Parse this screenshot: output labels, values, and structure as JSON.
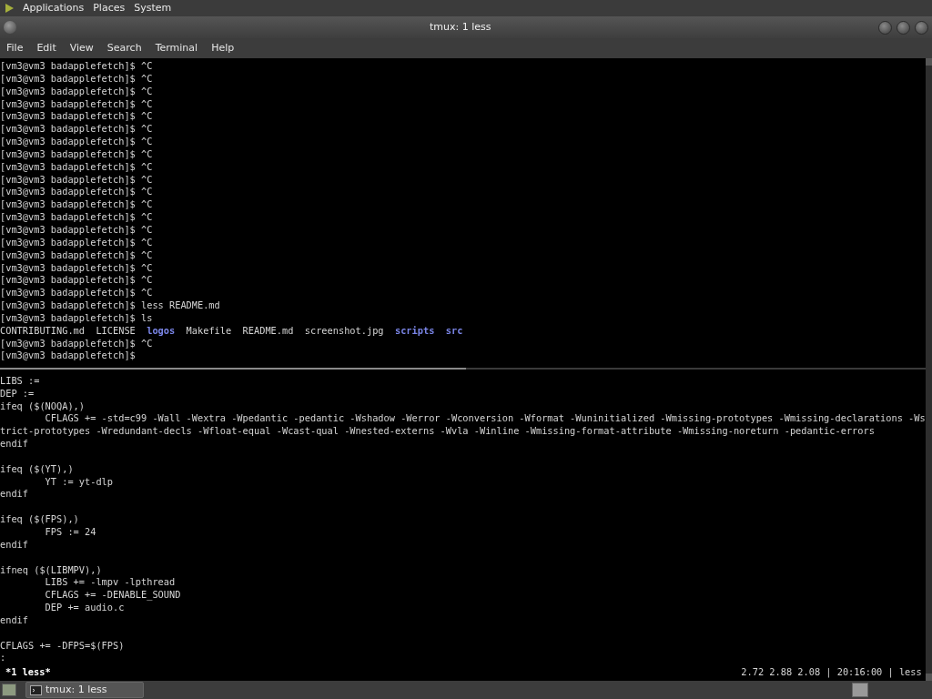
{
  "top_panel": {
    "menus": [
      "Applications",
      "Places",
      "System"
    ]
  },
  "window": {
    "title": "tmux: 1 less",
    "menubar": [
      "File",
      "Edit",
      "View",
      "Search",
      "Terminal",
      "Help"
    ]
  },
  "top_pane": {
    "active": true,
    "lines": [
      {
        "kind": "text",
        "text": "[vm3@vm3 badapplefetch]$ ^C"
      },
      {
        "kind": "text",
        "text": "[vm3@vm3 badapplefetch]$ ^C"
      },
      {
        "kind": "text",
        "text": "[vm3@vm3 badapplefetch]$ ^C"
      },
      {
        "kind": "text",
        "text": "[vm3@vm3 badapplefetch]$ ^C"
      },
      {
        "kind": "text",
        "text": "[vm3@vm3 badapplefetch]$ ^C"
      },
      {
        "kind": "text",
        "text": "[vm3@vm3 badapplefetch]$ ^C"
      },
      {
        "kind": "text",
        "text": "[vm3@vm3 badapplefetch]$ ^C"
      },
      {
        "kind": "text",
        "text": "[vm3@vm3 badapplefetch]$ ^C"
      },
      {
        "kind": "text",
        "text": "[vm3@vm3 badapplefetch]$ ^C"
      },
      {
        "kind": "text",
        "text": "[vm3@vm3 badapplefetch]$ ^C"
      },
      {
        "kind": "text",
        "text": "[vm3@vm3 badapplefetch]$ ^C"
      },
      {
        "kind": "text",
        "text": "[vm3@vm3 badapplefetch]$ ^C"
      },
      {
        "kind": "text",
        "text": "[vm3@vm3 badapplefetch]$ ^C"
      },
      {
        "kind": "text",
        "text": "[vm3@vm3 badapplefetch]$ ^C"
      },
      {
        "kind": "text",
        "text": "[vm3@vm3 badapplefetch]$ ^C"
      },
      {
        "kind": "text",
        "text": "[vm3@vm3 badapplefetch]$ ^C"
      },
      {
        "kind": "text",
        "text": "[vm3@vm3 badapplefetch]$ ^C"
      },
      {
        "kind": "text",
        "text": "[vm3@vm3 badapplefetch]$ ^C"
      },
      {
        "kind": "text",
        "text": "[vm3@vm3 badapplefetch]$ ^C"
      },
      {
        "kind": "text",
        "text": "[vm3@vm3 badapplefetch]$ less README.md"
      },
      {
        "kind": "text",
        "text": "[vm3@vm3 badapplefetch]$ ls"
      },
      {
        "kind": "listing",
        "entries": [
          {
            "text": "CONTRIBUTING.md",
            "kind": "file"
          },
          {
            "text": "LICENSE",
            "kind": "file"
          },
          {
            "text": "logos",
            "kind": "dir"
          },
          {
            "text": "Makefile",
            "kind": "file"
          },
          {
            "text": "README.md",
            "kind": "file"
          },
          {
            "text": "screenshot.jpg",
            "kind": "file"
          },
          {
            "text": "scripts",
            "kind": "dir"
          },
          {
            "text": "src",
            "kind": "dir"
          }
        ]
      },
      {
        "kind": "text",
        "text": "[vm3@vm3 badapplefetch]$ ^C"
      },
      {
        "kind": "text",
        "text": "[vm3@vm3 badapplefetch]$"
      }
    ]
  },
  "bottom_pane": {
    "lines": [
      {
        "kind": "text",
        "text": "LIBS :="
      },
      {
        "kind": "text",
        "text": "DEP :="
      },
      {
        "kind": "text",
        "text": "ifeq ($(NOQA),)"
      },
      {
        "kind": "text",
        "text": "        CFLAGS += -std=c99 -Wall -Wextra -Wpedantic -pedantic -Wshadow -Werror -Wconversion -Wformat -Wuninitialized -Wmissing-prototypes -Wmissing-declarations -Ws"
      },
      {
        "kind": "text",
        "text": "trict-prototypes -Wredundant-decls -Wfloat-equal -Wcast-qual -Wnested-externs -Wvla -Winline -Wmissing-format-attribute -Wmissing-noreturn -pedantic-errors"
      },
      {
        "kind": "text",
        "text": "endif"
      },
      {
        "kind": "blank"
      },
      {
        "kind": "text",
        "text": "ifeq ($(YT),)"
      },
      {
        "kind": "text",
        "text": "        YT := yt-dlp"
      },
      {
        "kind": "text",
        "text": "endif"
      },
      {
        "kind": "blank"
      },
      {
        "kind": "text",
        "text": "ifeq ($(FPS),)"
      },
      {
        "kind": "text",
        "text": "        FPS := 24"
      },
      {
        "kind": "text",
        "text": "endif"
      },
      {
        "kind": "blank"
      },
      {
        "kind": "text",
        "text": "ifneq ($(LIBMPV),)"
      },
      {
        "kind": "text",
        "text": "        LIBS += -lmpv -lpthread"
      },
      {
        "kind": "text",
        "text": "        CFLAGS += -DENABLE_SOUND"
      },
      {
        "kind": "text",
        "text": "        DEP += audio.c"
      },
      {
        "kind": "text",
        "text": "endif"
      },
      {
        "kind": "blank"
      },
      {
        "kind": "text",
        "text": "CFLAGS += -DFPS=$(FPS)"
      },
      {
        "kind": "text",
        "text": ":"
      }
    ]
  },
  "tmux_status": {
    "window": "*1 less*",
    "right": "2.72 2.88 2.08 | 20:16:00 | less"
  },
  "taskbar": {
    "tasks": [
      {
        "label": "tmux: 1 less",
        "selected": true
      }
    ]
  }
}
